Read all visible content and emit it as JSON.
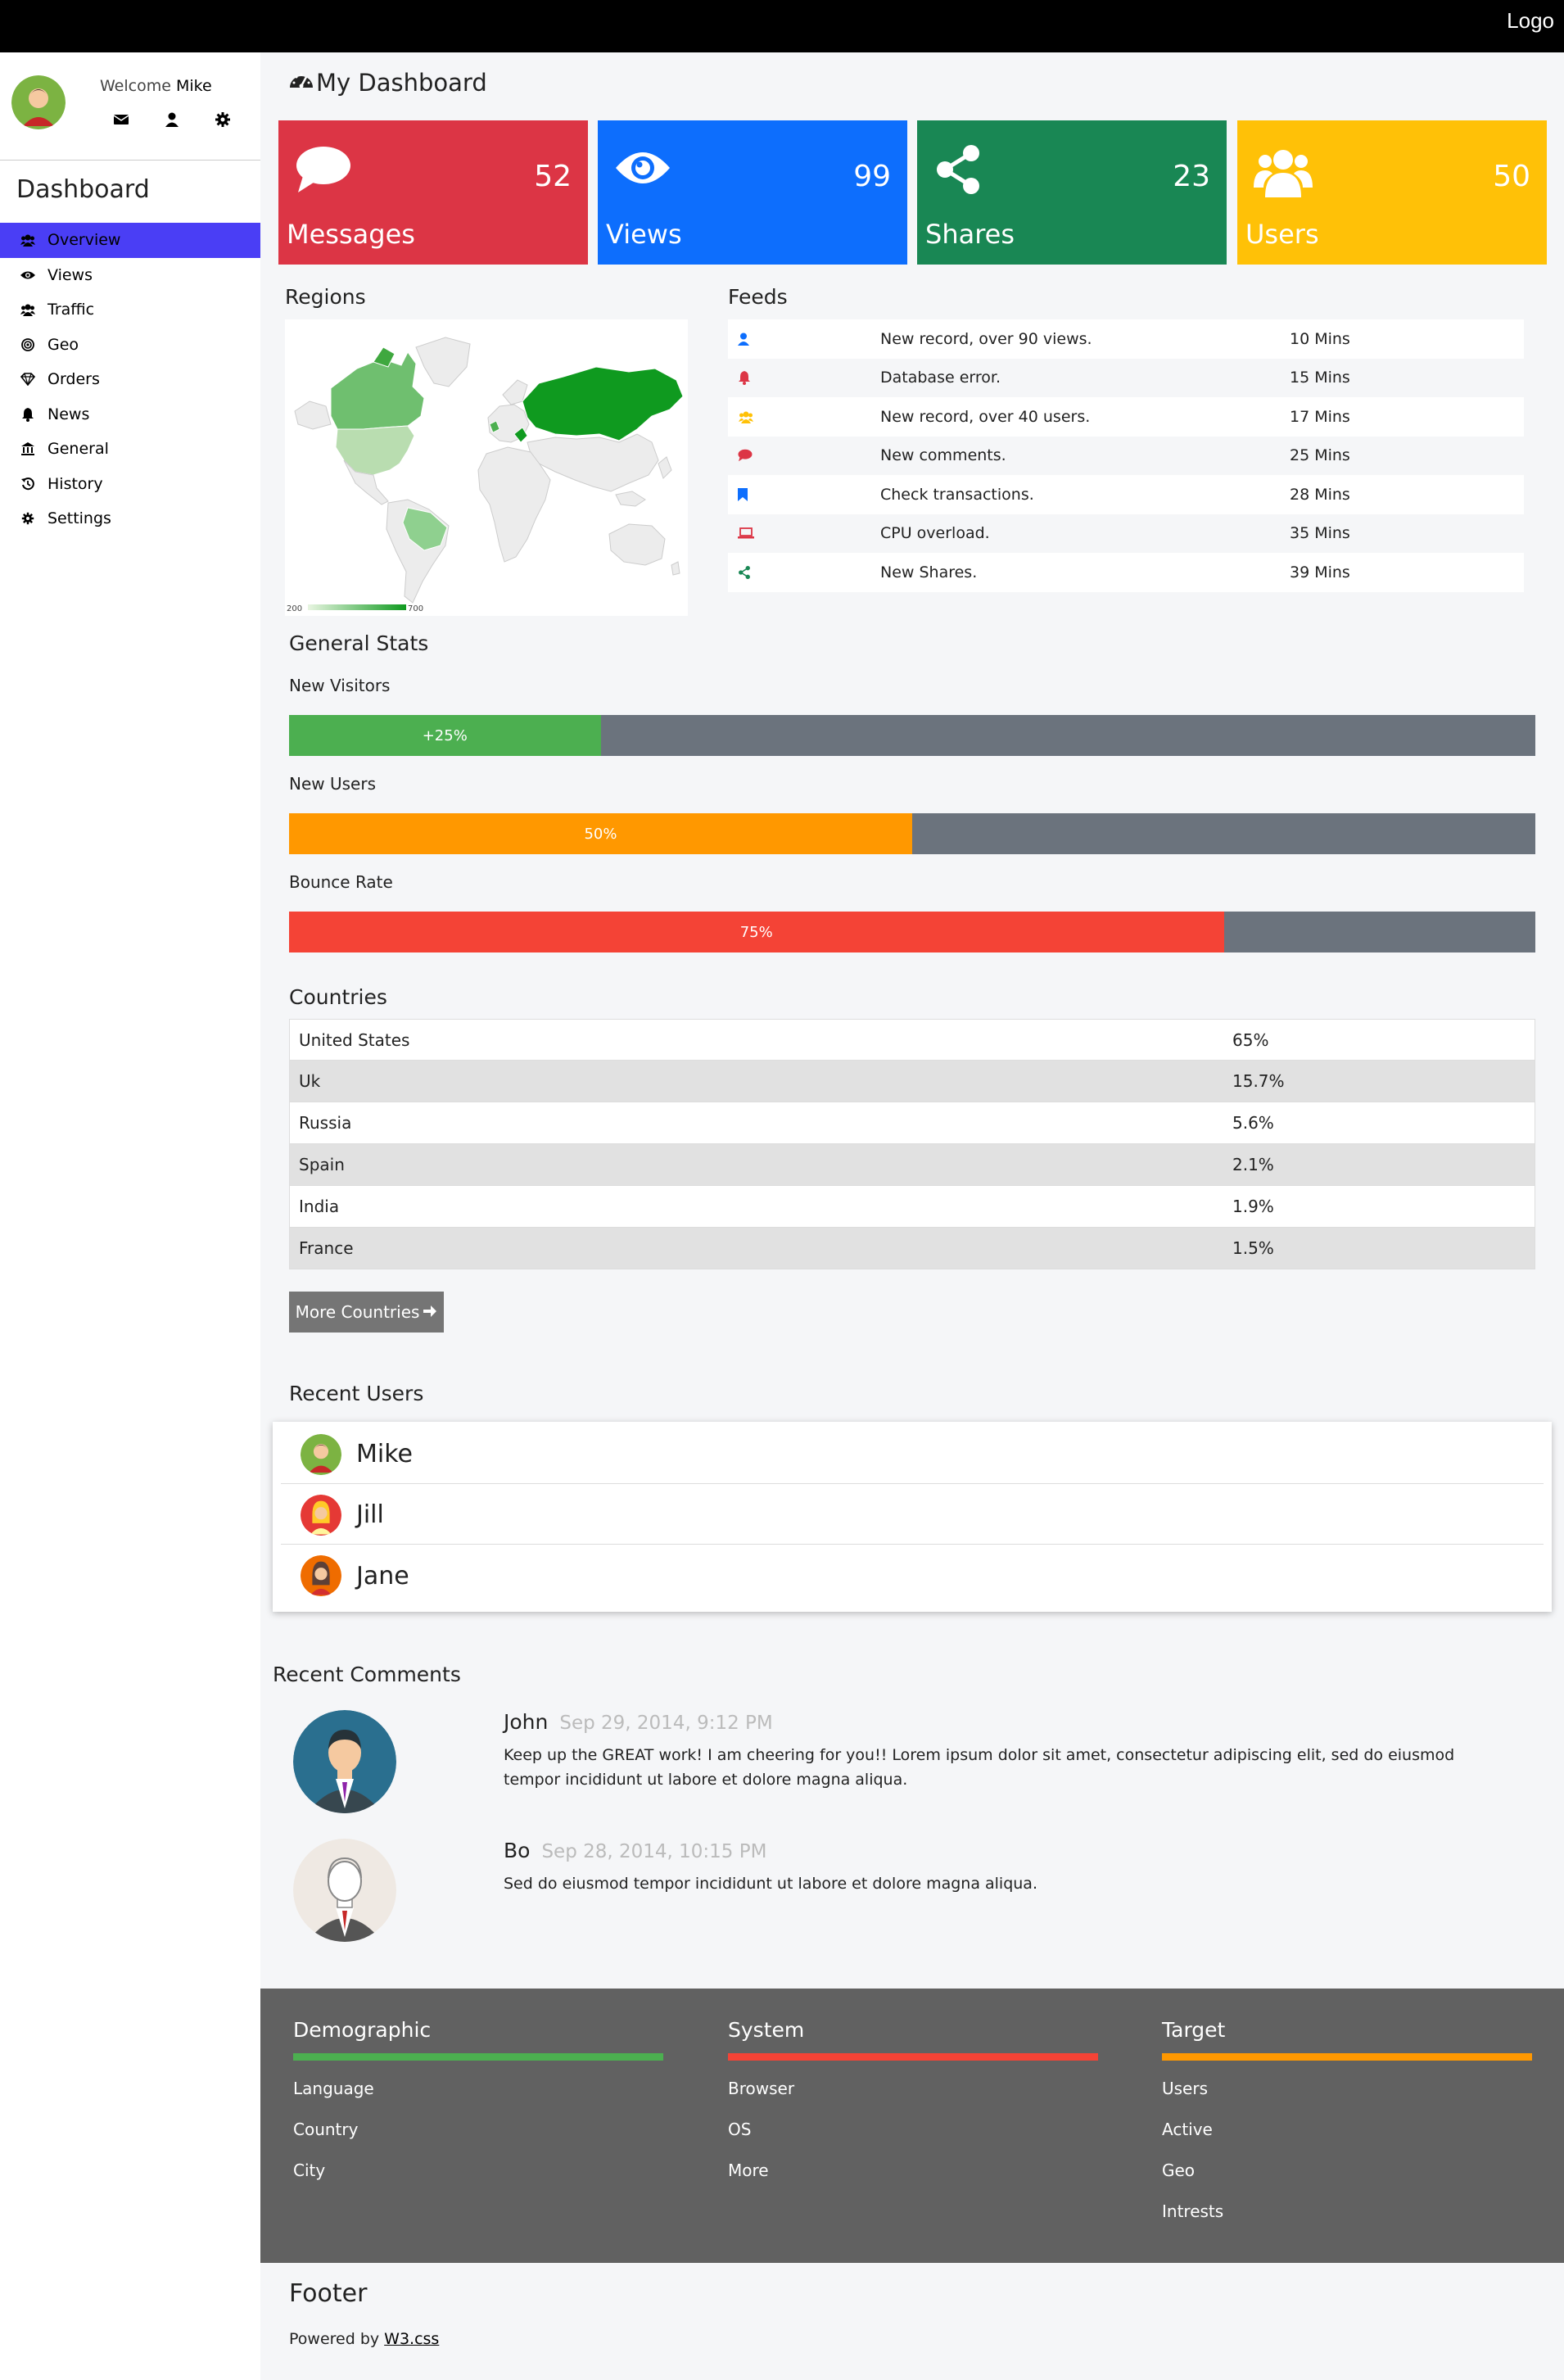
{
  "topbar": {
    "logo": "Logo"
  },
  "sidebar": {
    "welcome_prefix": "Welcome",
    "user_name": "Mike",
    "title": "Dashboard",
    "icons": [
      "envelope-icon",
      "user-icon",
      "gear-icon"
    ],
    "items": [
      {
        "label": "Overview",
        "icon": "users-icon",
        "active": true
      },
      {
        "label": "Views",
        "icon": "eye-icon"
      },
      {
        "label": "Traffic",
        "icon": "users-icon"
      },
      {
        "label": "Geo",
        "icon": "bullseye-icon"
      },
      {
        "label": "Orders",
        "icon": "diamond-icon"
      },
      {
        "label": "News",
        "icon": "bell-icon"
      },
      {
        "label": "General",
        "icon": "bank-icon"
      },
      {
        "label": "History",
        "icon": "history-icon"
      },
      {
        "label": "Settings",
        "icon": "gear-icon"
      }
    ]
  },
  "main": {
    "title": "My Dashboard",
    "title_icon": "dashboard-icon"
  },
  "tiles": [
    {
      "label": "Messages",
      "value": "52",
      "icon": "comment-icon",
      "color": "#dc3545"
    },
    {
      "label": "Views",
      "value": "99",
      "icon": "eye-icon",
      "color": "#0d6efd"
    },
    {
      "label": "Shares",
      "value": "23",
      "icon": "share-icon",
      "color": "#198754"
    },
    {
      "label": "Users",
      "value": "50",
      "icon": "users-icon",
      "color": "#ffc107"
    }
  ],
  "regions": {
    "label": "Regions",
    "legend_min": "200",
    "legend_max": "700"
  },
  "feeds": {
    "label": "Feeds",
    "rows": [
      {
        "icon": "user-icon",
        "color": "#0d6efd",
        "text": "New record, over 90 views.",
        "time": "10 Mins"
      },
      {
        "icon": "bell-icon",
        "color": "#dc3545",
        "text": "Database error.",
        "time": "15 Mins"
      },
      {
        "icon": "users-icon",
        "color": "#ffc107",
        "text": "New record, over 40 users.",
        "time": "17 Mins"
      },
      {
        "icon": "comment-icon",
        "color": "#dc3545",
        "text": "New comments.",
        "time": "25 Mins"
      },
      {
        "icon": "bookmark-icon",
        "color": "#0d6efd",
        "text": "Check transactions.",
        "time": "28 Mins"
      },
      {
        "icon": "laptop-icon",
        "color": "#dc3545",
        "text": "CPU overload.",
        "time": "35 Mins"
      },
      {
        "icon": "share-icon",
        "color": "#198754",
        "text": "New Shares.",
        "time": "39 Mins"
      }
    ]
  },
  "general_stats": {
    "label": "General Stats",
    "stats": [
      {
        "label": "New Visitors",
        "text": "+25%",
        "fraction": 0.25,
        "color": "#4caf50"
      },
      {
        "label": "New Users",
        "text": "50%",
        "fraction": 0.5,
        "color": "#ff9800"
      },
      {
        "label": "Bounce Rate",
        "text": "75%",
        "fraction": 0.75,
        "color": "#f44336"
      }
    ],
    "track_color": "#6b737d"
  },
  "countries": {
    "label": "Countries",
    "rows": [
      {
        "name": "United States",
        "pct": "65%"
      },
      {
        "name": "Uk",
        "pct": "15.7%"
      },
      {
        "name": "Russia",
        "pct": "5.6%"
      },
      {
        "name": "Spain",
        "pct": "2.1%"
      },
      {
        "name": "India",
        "pct": "1.9%"
      },
      {
        "name": "France",
        "pct": "1.5%"
      }
    ],
    "more_button": "More Countries"
  },
  "recent_users": {
    "label": "Recent Users",
    "users": [
      "Mike",
      "Jill",
      "Jane"
    ]
  },
  "recent_comments": {
    "label": "Recent Comments",
    "comments": [
      {
        "author": "John",
        "date": "Sep 29, 2014, 9:12 PM",
        "text": "Keep up the GREAT work! I am cheering for you!! Lorem ipsum dolor sit amet, consectetur adipiscing elit, sed do eiusmod tempor incididunt ut labore et dolore magna aliqua."
      },
      {
        "author": "Bo",
        "date": "Sep 28, 2014, 10:15 PM",
        "text": "Sed do eiusmod tempor incididunt ut labore et dolore magna aliqua."
      }
    ]
  },
  "footer_columns": [
    {
      "title": "Demographic",
      "color": "#4caf50",
      "links": [
        "Language",
        "Country",
        "City"
      ]
    },
    {
      "title": "System",
      "color": "#f44336",
      "links": [
        "Browser",
        "OS",
        "More"
      ]
    },
    {
      "title": "Target",
      "color": "#ff9800",
      "links": [
        "Users",
        "Active",
        "Geo",
        "Intrests"
      ]
    }
  ],
  "footer": {
    "title": "Footer",
    "powered_prefix": "Powered by",
    "powered_link": "W3.css"
  }
}
